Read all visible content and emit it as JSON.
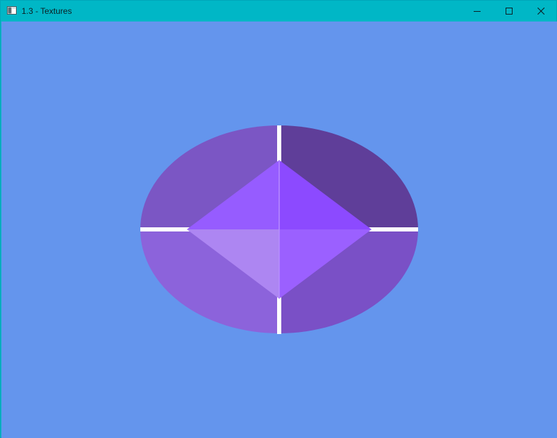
{
  "window": {
    "title": "1.3 - Textures",
    "icon": "console-window-icon",
    "controls": [
      "minimize-icon",
      "maximize-icon",
      "close-icon"
    ]
  },
  "viewport": {
    "clear_color": "#6495ed",
    "shapes": {
      "ellipse_quadrant_colors": {
        "top_left": "#7b56c4",
        "top_right": "#5f3e99",
        "bottom_left": "#8c63db",
        "bottom_right": "#7a50c6"
      },
      "diamond_face_colors": {
        "top_left": "#965cff",
        "top_right": "#8c4aff",
        "bottom_left": "#ad86f2",
        "bottom_right": "#9b60ff"
      },
      "cross_color": "#ffffff",
      "diamond_edge_color": "#b88dff"
    }
  }
}
